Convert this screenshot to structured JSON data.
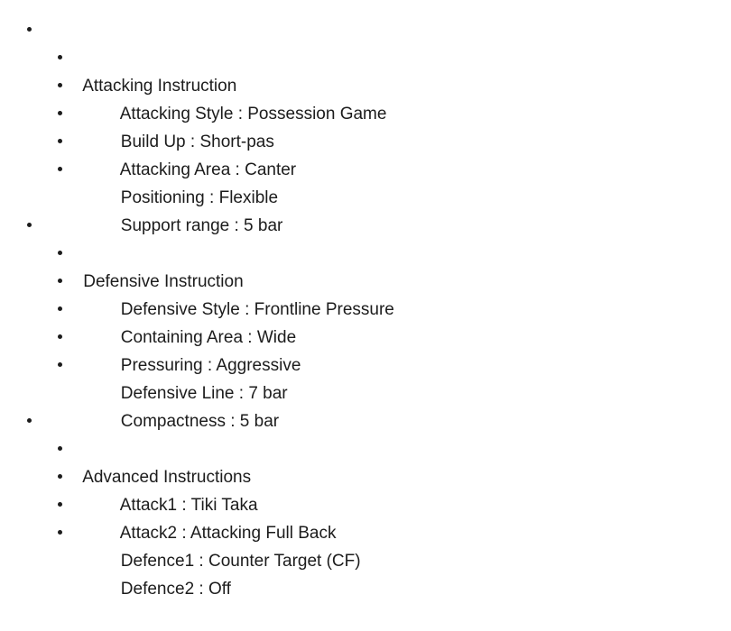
{
  "document": {
    "text_color": "#1c1c1c",
    "background_color": "#ffffff",
    "bullet_glyph": "bullet-dot",
    "groups": [
      {
        "heading": "Attacking Instruction",
        "items": [
          "Attacking Style : Possession Game",
          "Build Up : Short-pas",
          "Attacking Area : Canter",
          "Positioning : Flexible",
          "Support range : 5 bar"
        ]
      },
      {
        "heading": "Defensive Instruction",
        "items": [
          "Defensive Style : Frontline Pressure",
          "Containing Area : Wide",
          "Pressuring : Aggressive",
          "Defensive Line : 7 bar",
          "Compactness : 5 bar"
        ]
      },
      {
        "heading": "Advanced Instructions",
        "items": [
          "Attack1 : Tiki Taka",
          "Attack2 : Attacking Full Back",
          "Defence1 : Counter Target (CF)",
          "Defence2 : Off"
        ]
      }
    ]
  }
}
